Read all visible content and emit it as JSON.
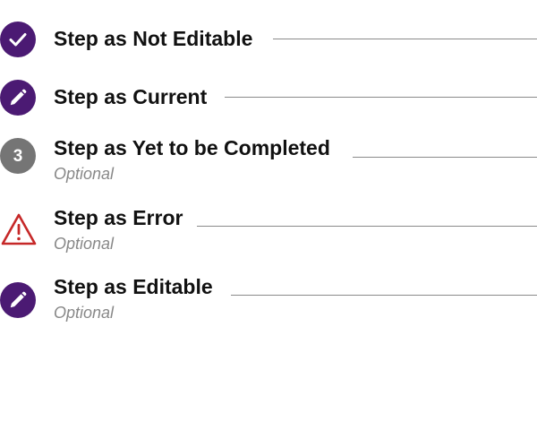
{
  "colors": {
    "accent": "#4b1a73",
    "pending": "#757575",
    "error": "#c62828",
    "connector": "#8a8a8a"
  },
  "steps": [
    {
      "label": "Step as Not Editable",
      "state": "done",
      "icon": "check-icon",
      "optional": null
    },
    {
      "label": "Step as Current",
      "state": "current",
      "icon": "pencil-icon",
      "optional": null
    },
    {
      "label": "Step as Yet to be Completed",
      "state": "pending",
      "icon": "number-badge",
      "number": "3",
      "optional": "Optional"
    },
    {
      "label": "Step as Error",
      "state": "error",
      "icon": "warning-icon",
      "optional": "Optional"
    },
    {
      "label": "Step as Editable",
      "state": "editable",
      "icon": "pencil-icon",
      "optional": "Optional"
    }
  ]
}
